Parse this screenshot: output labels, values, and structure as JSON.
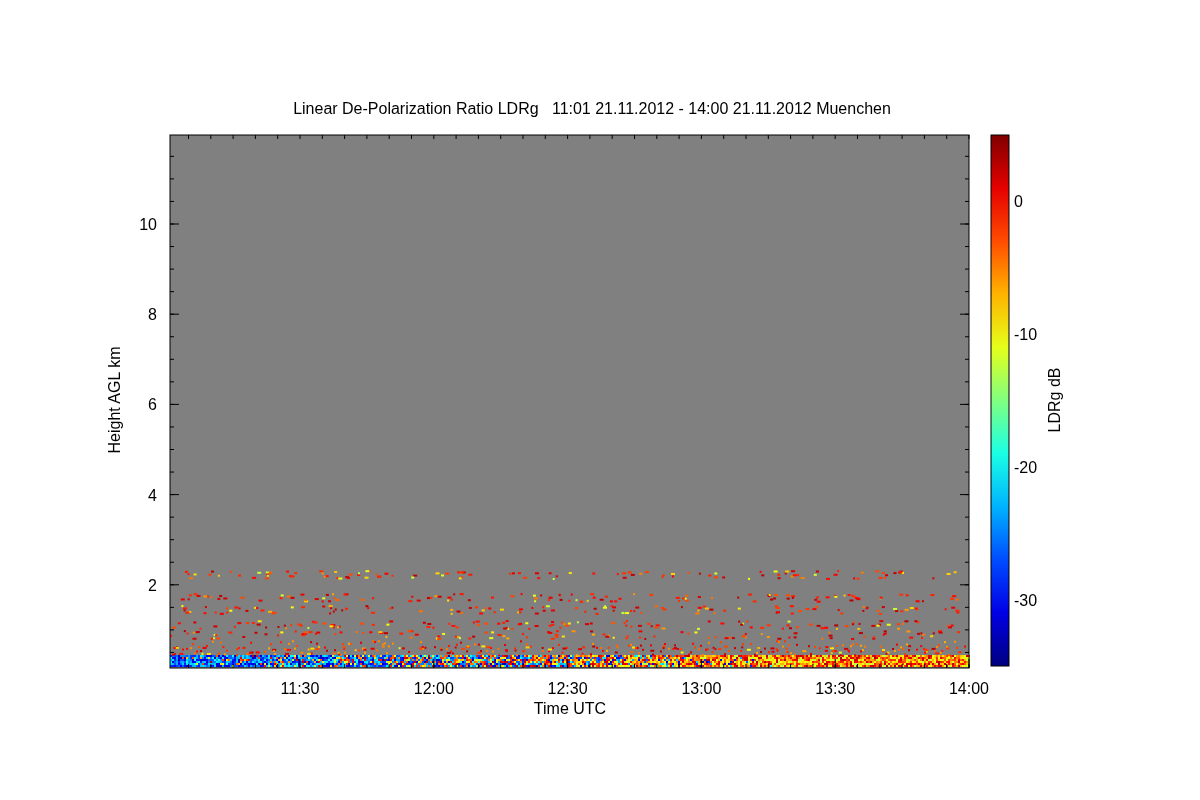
{
  "title": "Linear De-Polarization Ratio LDRg   11:01 21.11.2012 - 14:00 21.11.2012 Muenchen",
  "ylabel": "Height AGL km",
  "yticks": [
    "10",
    "8",
    "6",
    "4",
    "2"
  ],
  "xlabel": "Time UTC",
  "xticks": [
    "11:30",
    "12:00",
    "12:30",
    "13:00",
    "13:30",
    "14:00"
  ],
  "colorbar": {
    "label": "LDRg dB",
    "ticks": [
      "0",
      "-10",
      "-20",
      "-30"
    ]
  }
}
